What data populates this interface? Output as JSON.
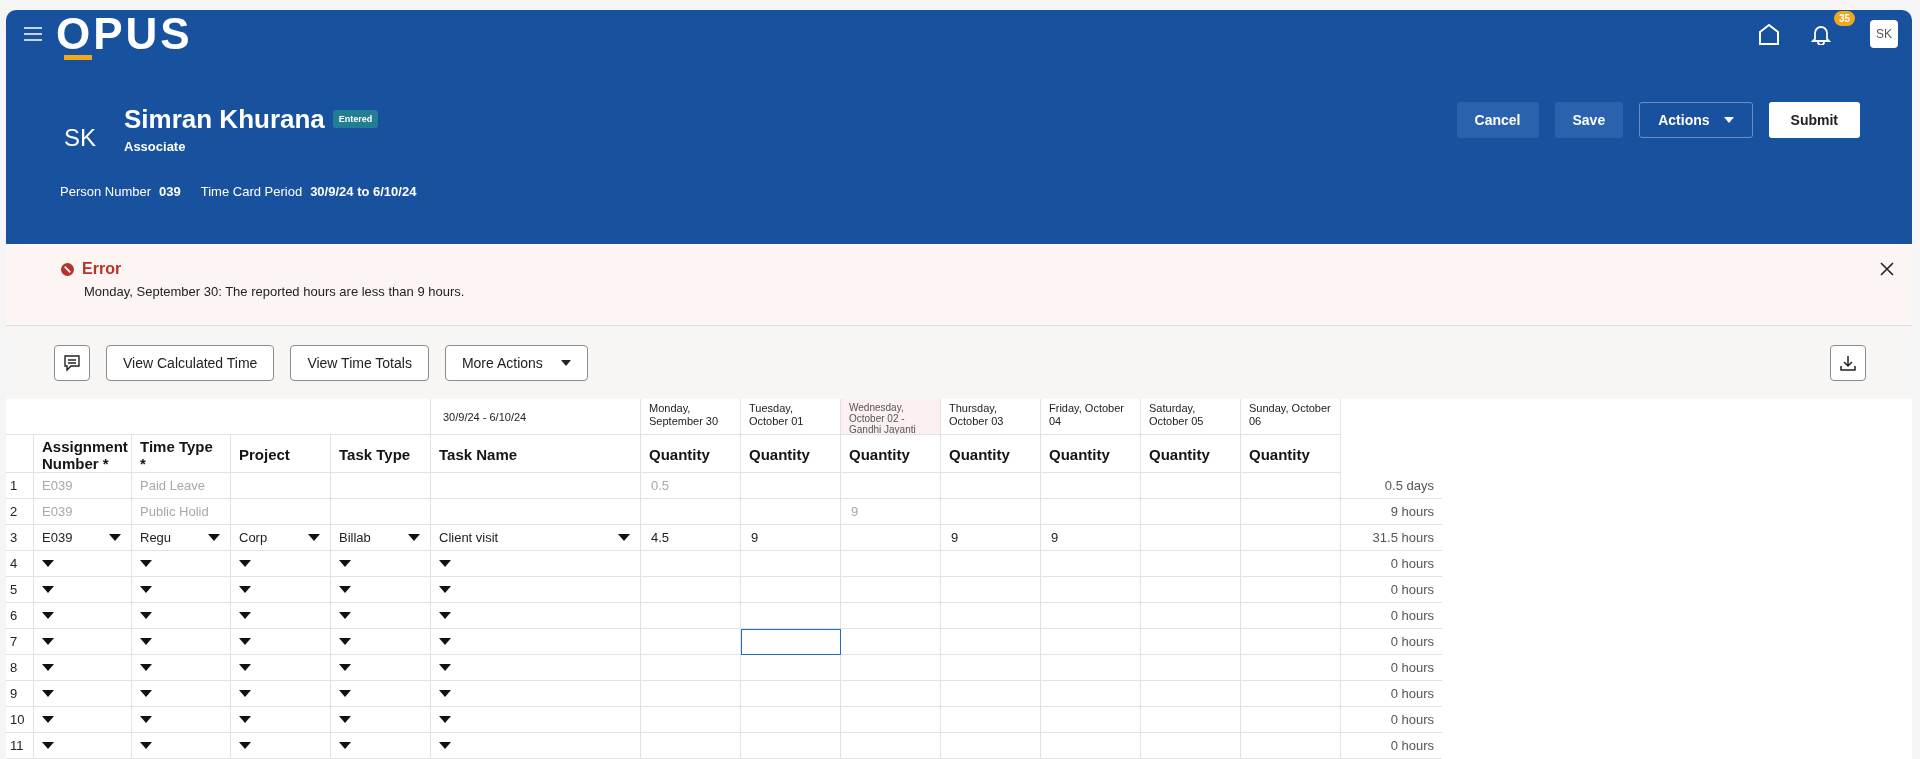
{
  "app_bar": {
    "logo": "OPUS",
    "notifications": "35",
    "user_initials": "SK"
  },
  "person": {
    "initials": "SK",
    "name": "Simran Khurana",
    "status": "Entered",
    "role": "Associate",
    "details": [
      {
        "label": "Person Number",
        "value": "039"
      },
      {
        "label": "Time Card Period",
        "value": "30/9/24 to 6/10/24"
      }
    ]
  },
  "header_buttons": [
    {
      "label": "Cancel",
      "kind": "secondary"
    },
    {
      "label": "Save",
      "kind": "secondary"
    },
    {
      "label": "Actions",
      "kind": "menu"
    },
    {
      "label": "Submit",
      "kind": "primary"
    }
  ],
  "error": {
    "title": "Error",
    "message": "Monday, September 30: The reported hours are less than 9 hours."
  },
  "toolbar": {
    "buttons": [
      {
        "label": "View Calculated Time",
        "kind": "plain"
      },
      {
        "label": "View Time Totals",
        "kind": "plain"
      },
      {
        "label": "More Actions",
        "kind": "menu"
      }
    ]
  },
  "grid": {
    "period": "30/9/24 - 6/10/24",
    "columns": [
      "Assignment Number *",
      "Time Type *",
      "Project",
      "Task Type",
      "Task Name"
    ],
    "days": [
      {
        "label": "Monday, September 30",
        "column": "Quantity",
        "holiday": false
      },
      {
        "label": "Tuesday, October 01",
        "column": "Quantity",
        "holiday": false
      },
      {
        "label": "Wednesday, October 02 - Gandhi Jayanti",
        "column": "Quantity",
        "holiday": true
      },
      {
        "label": "Thursday, October 03",
        "column": "Quantity",
        "holiday": false
      },
      {
        "label": "Friday, October 04",
        "column": "Quantity",
        "holiday": false
      },
      {
        "label": "Saturday, October 05",
        "column": "Quantity",
        "holiday": false
      },
      {
        "label": "Sunday, October 06",
        "column": "Quantity",
        "holiday": false
      }
    ],
    "rows": [
      {
        "number": "1",
        "editable": false,
        "fields": [
          "E039",
          "Paid Leave"
        ],
        "cells": [
          {
            "value": "0.5",
            "selected": false
          },
          {
            "selected": false
          },
          {
            "selected": false
          },
          {
            "selected": false
          },
          {
            "selected": false
          },
          {
            "selected": false
          },
          {
            "selected": false
          }
        ],
        "total": "0.5 days"
      },
      {
        "number": "2",
        "editable": false,
        "fields": [
          "E039",
          "Public Holid"
        ],
        "cells": [
          {
            "selected": false
          },
          {
            "selected": false
          },
          {
            "value": "9",
            "selected": false
          },
          {
            "selected": false
          },
          {
            "selected": false
          },
          {
            "selected": false
          },
          {
            "selected": false
          }
        ],
        "total": "9 hours"
      },
      {
        "number": "3",
        "editable": true,
        "fields": [
          "E039",
          "Regu",
          "Corp",
          "Billab",
          "Client visit"
        ],
        "cells": [
          {
            "value": "4.5",
            "selected": false
          },
          {
            "value": "9",
            "selected": false
          },
          {
            "selected": false
          },
          {
            "value": "9",
            "selected": false
          },
          {
            "value": "9",
            "selected": false
          },
          {
            "selected": false
          },
          {
            "selected": false
          }
        ],
        "total": "31.5 hours"
      },
      {
        "number": "4",
        "editable": true,
        "cells": [
          {
            "selected": false
          },
          {
            "selected": false
          },
          {
            "selected": false
          },
          {
            "selected": false
          },
          {
            "selected": false
          },
          {
            "selected": false
          },
          {
            "selected": false
          }
        ],
        "total": "0 hours"
      },
      {
        "number": "5",
        "editable": true,
        "cells": [
          {
            "selected": false
          },
          {
            "selected": false
          },
          {
            "selected": false
          },
          {
            "selected": false
          },
          {
            "selected": false
          },
          {
            "selected": false
          },
          {
            "selected": false
          }
        ],
        "total": "0 hours"
      },
      {
        "number": "6",
        "editable": true,
        "cells": [
          {
            "selected": false
          },
          {
            "selected": false
          },
          {
            "selected": false
          },
          {
            "selected": false
          },
          {
            "selected": false
          },
          {
            "selected": false
          },
          {
            "selected": false
          }
        ],
        "total": "0 hours"
      },
      {
        "number": "7",
        "editable": true,
        "cells": [
          {
            "selected": false
          },
          {
            "selected": true
          },
          {
            "selected": false
          },
          {
            "selected": false
          },
          {
            "selected": false
          },
          {
            "selected": false
          },
          {
            "selected": false
          }
        ],
        "total": "0 hours"
      },
      {
        "number": "8",
        "editable": true,
        "cells": [
          {
            "selected": false
          },
          {
            "selected": false
          },
          {
            "selected": false
          },
          {
            "selected": false
          },
          {
            "selected": false
          },
          {
            "selected": false
          },
          {
            "selected": false
          }
        ],
        "total": "0 hours"
      },
      {
        "number": "9",
        "editable": true,
        "cells": [
          {
            "selected": false
          },
          {
            "selected": false
          },
          {
            "selected": false
          },
          {
            "selected": false
          },
          {
            "selected": false
          },
          {
            "selected": false
          },
          {
            "selected": false
          }
        ],
        "total": "0 hours"
      },
      {
        "number": "10",
        "editable": true,
        "cells": [
          {
            "selected": false
          },
          {
            "selected": false
          },
          {
            "selected": false
          },
          {
            "selected": false
          },
          {
            "selected": false
          },
          {
            "selected": false
          },
          {
            "selected": false
          }
        ],
        "total": "0 hours"
      },
      {
        "number": "11",
        "editable": true,
        "cells": [
          {
            "selected": false
          },
          {
            "selected": false
          },
          {
            "selected": false
          },
          {
            "selected": false
          },
          {
            "selected": false
          },
          {
            "selected": false
          },
          {
            "selected": false
          }
        ],
        "total": "0 hours"
      }
    ]
  }
}
